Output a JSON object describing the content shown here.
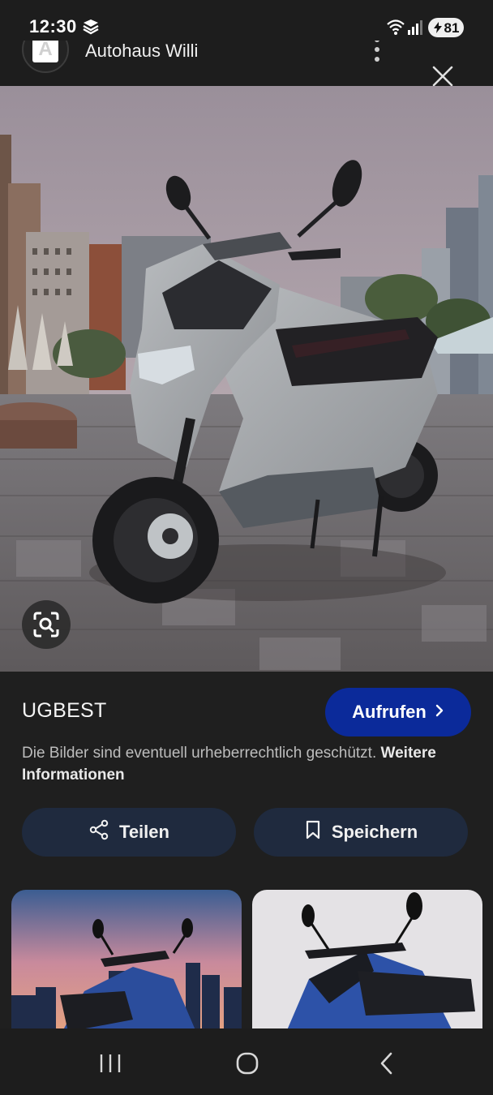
{
  "status_bar": {
    "time": "12:30",
    "battery": "81",
    "icons": [
      "cloud-sync-icon",
      "wifi-icon",
      "signal-icon",
      "battery-icon"
    ]
  },
  "header": {
    "site_name": "Autohaus Willi",
    "logo_letter": "A",
    "icons": [
      "more-vert-icon",
      "close-icon"
    ]
  },
  "hero_image": {
    "subject": "grey electric scooter on a paved plaza",
    "lens_icon": "lens-search-icon"
  },
  "result": {
    "source_name": "UGBEST",
    "visit_label": "Aufrufen",
    "copyright_text": "Die Bilder sind eventuell urheberrechtlich geschützt.",
    "more_info_label": "Weitere Informationen",
    "share_label": "Teilen",
    "save_label": "Speichern"
  },
  "related_thumbnails": [
    {
      "subject": "blue scooter at dusk skyline"
    },
    {
      "subject": "blue scooter on light background"
    }
  ],
  "nav_bar": {
    "icons": [
      "recents-icon",
      "home-icon",
      "back-icon"
    ]
  },
  "colors": {
    "background": "#1f1f1f",
    "visit_button": "#0b2a9a",
    "action_button": "#1f2a3e"
  }
}
